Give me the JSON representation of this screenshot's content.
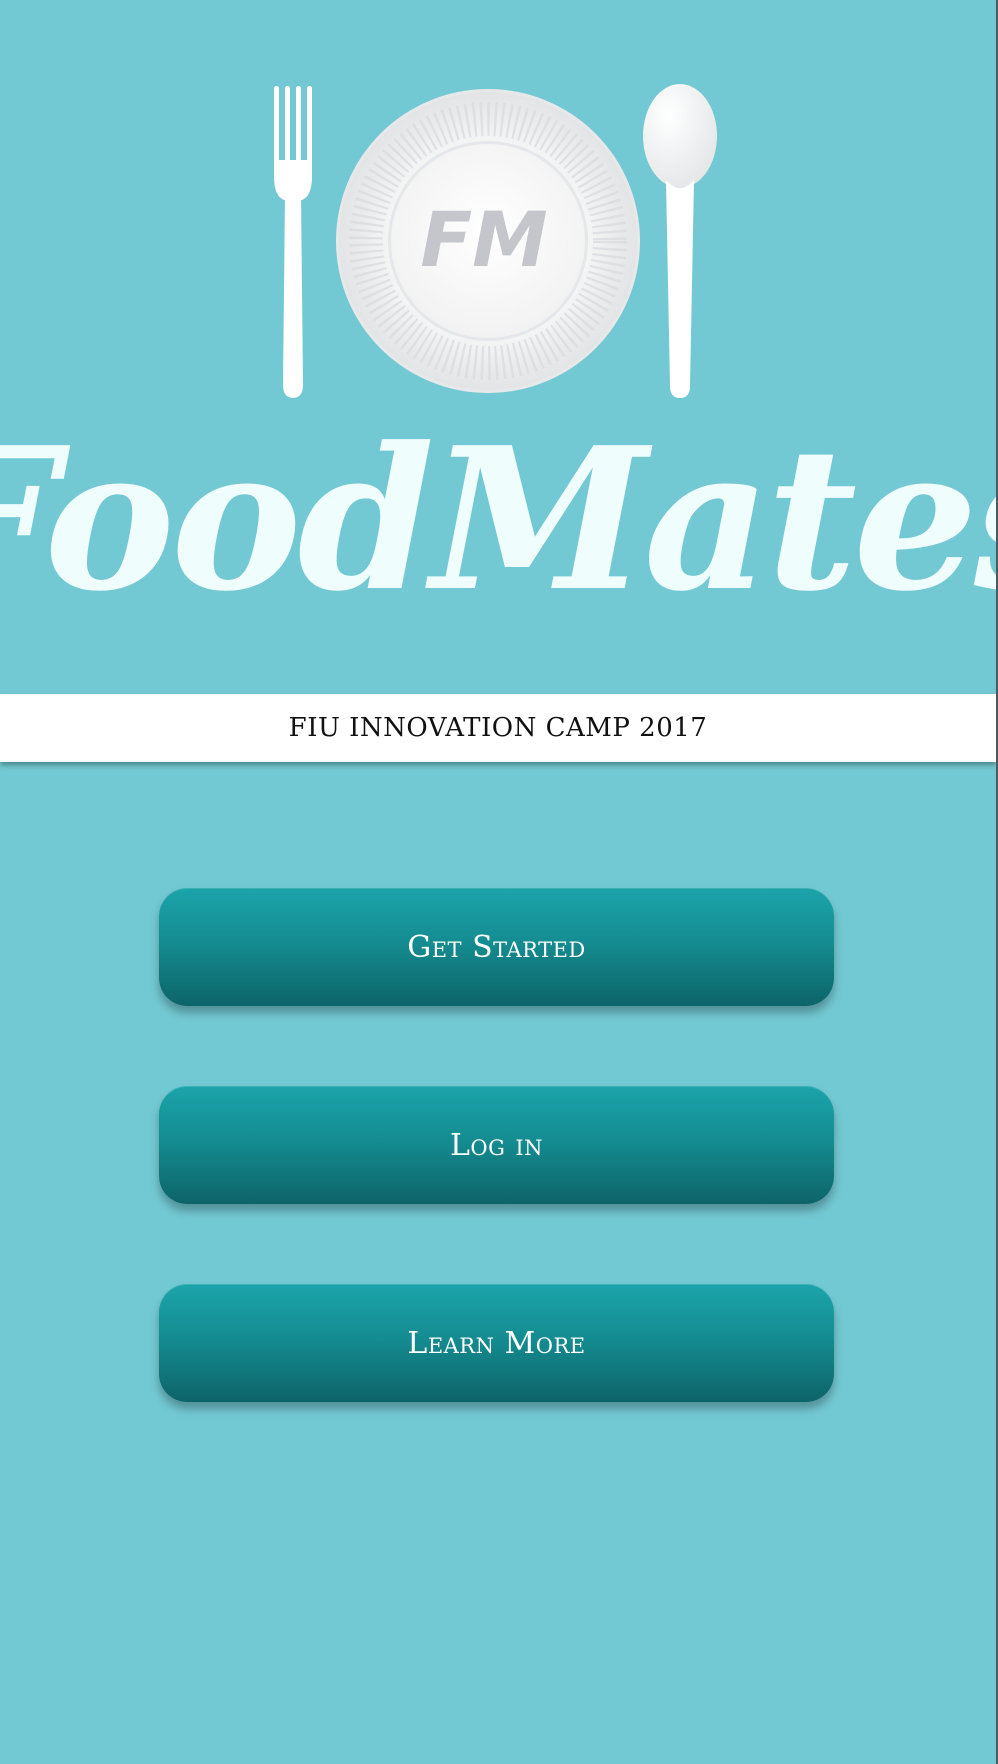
{
  "app": {
    "title": "FoodMates",
    "monogram": "FM"
  },
  "banner": {
    "text": "FIU INNOVATION CAMP 2017"
  },
  "buttons": {
    "get_started": "Get Started",
    "log_in": "Log in",
    "learn_more": "Learn More"
  },
  "icons": [
    "fork-icon",
    "plate-icon",
    "spoon-icon"
  ],
  "colors": {
    "background": "#73c9d3",
    "button_top": "#1ba4aa",
    "button_bottom": "#0d6468",
    "logo_text": "#effdfd",
    "banner_bg": "#ffffff",
    "monogram": "#c4c6cc"
  }
}
